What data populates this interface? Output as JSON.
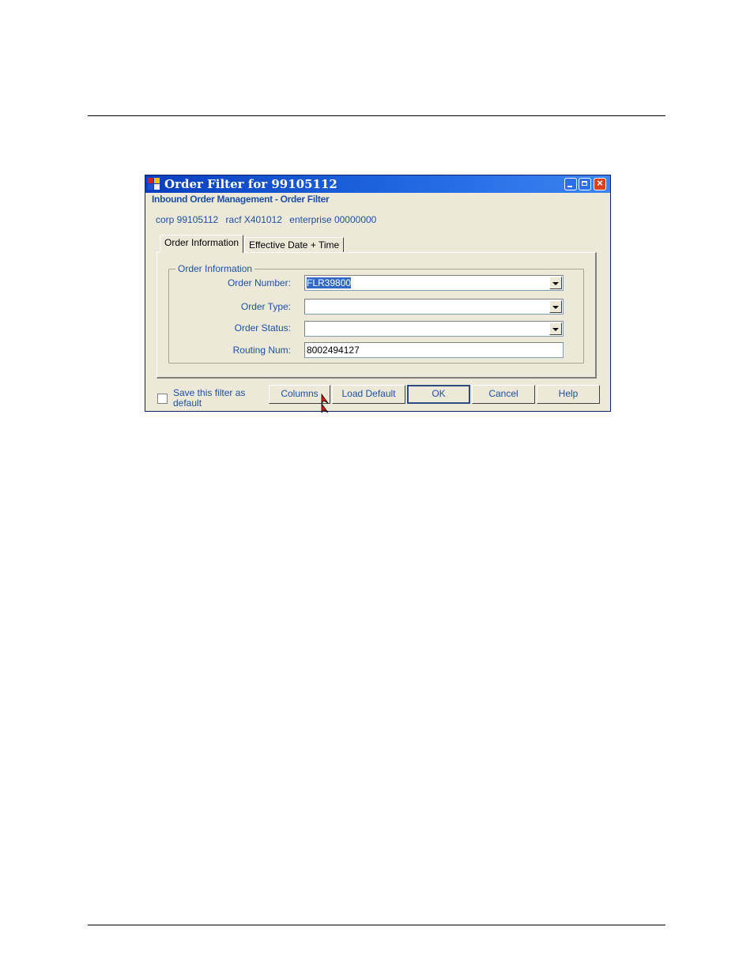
{
  "window": {
    "title": "Order Filter for 99105112",
    "subtitle": "Inbound Order Management - Order Filter",
    "info": {
      "corp": "corp 99105112",
      "racf": "racf X401012",
      "enterprise": "enterprise 00000000"
    }
  },
  "tabs": [
    {
      "label": "Order Information",
      "active": true
    },
    {
      "label": "Effective Date + Time",
      "active": false
    }
  ],
  "group": {
    "legend": "Order Information",
    "fields": {
      "order_number": {
        "label": "Order Number:",
        "value": "FLR39800"
      },
      "order_type": {
        "label": "Order Type:",
        "value": ""
      },
      "order_status": {
        "label": "Order Status:",
        "value": ""
      },
      "routing_num": {
        "label": "Routing Num:",
        "value": "8002494127"
      }
    }
  },
  "footer": {
    "save_filter_label": "Save this filter as default",
    "save_filter_checked": false,
    "buttons": {
      "columns": "Columns",
      "load_default": "Load Default",
      "ok": "OK",
      "cancel": "Cancel",
      "help": "Help"
    }
  },
  "colors": {
    "title_bar": "#1f66e0",
    "label_text": "#1e4fa8",
    "window_bg": "#ece9d8",
    "selection": "#316ac5"
  }
}
